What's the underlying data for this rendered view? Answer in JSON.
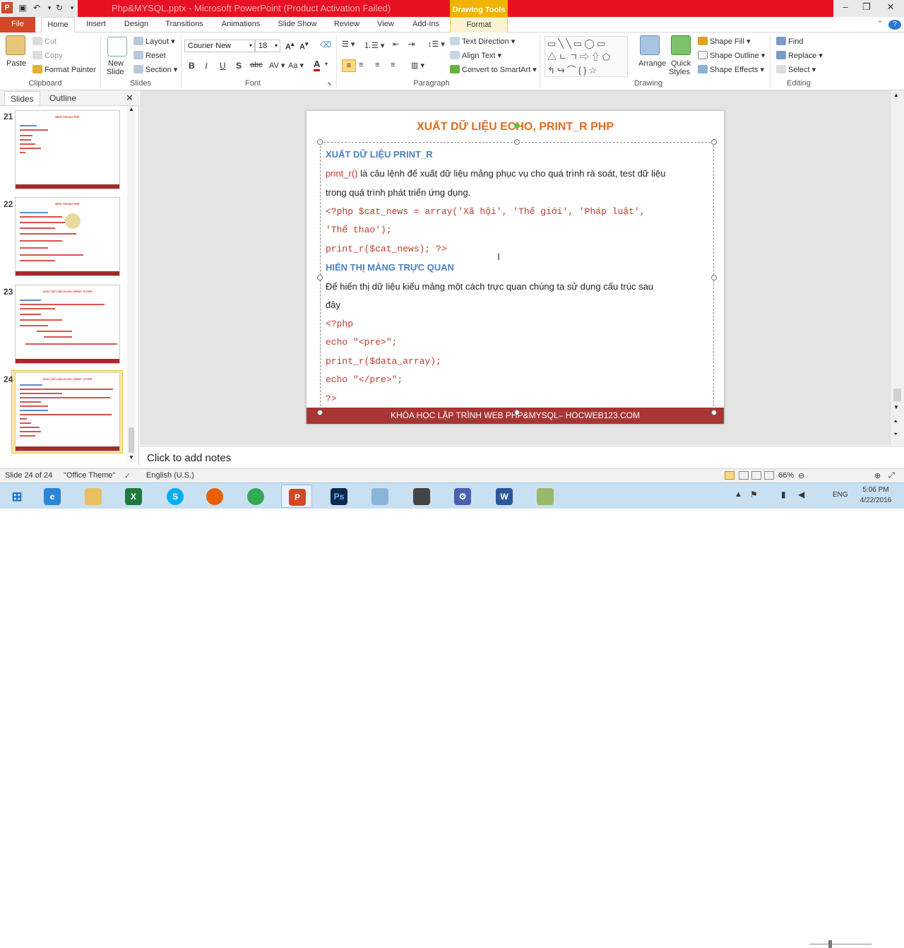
{
  "titlebar": {
    "title": "Php&MYSQL.pptx - Microsoft PowerPoint (Product Activation Failed)",
    "contextual_tab": "Drawing Tools"
  },
  "tabs": [
    "File",
    "Home",
    "Insert",
    "Design",
    "Transitions",
    "Animations",
    "Slide Show",
    "Review",
    "View",
    "Add-Ins",
    "Format"
  ],
  "ribbon": {
    "clipboard": {
      "paste": "Paste",
      "cut": "Cut",
      "copy": "Copy",
      "format_painter": "Format Painter",
      "label": "Clipboard"
    },
    "slides": {
      "new_slide_1": "New",
      "new_slide_2": "Slide",
      "layout": "Layout",
      "reset": "Reset",
      "section": "Section",
      "label": "Slides"
    },
    "font": {
      "name": "Courier New",
      "size": "18",
      "label": "Font"
    },
    "paragraph": {
      "text_direction": "Text Direction",
      "align_text": "Align Text",
      "smartart": "Convert to SmartArt",
      "label": "Paragraph"
    },
    "drawing": {
      "arrange": "Arrange",
      "quick_styles_1": "Quick",
      "quick_styles_2": "Styles",
      "shape_fill": "Shape Fill",
      "shape_outline": "Shape Outline",
      "shape_effects": "Shape Effects",
      "label": "Drawing"
    },
    "editing": {
      "find": "Find",
      "replace": "Replace",
      "select": "Select",
      "label": "Editing"
    }
  },
  "left_panel": {
    "tab_slides": "Slides",
    "tab_outline": "Outline",
    "thumbnails": [
      {
        "num": "21",
        "title": "BIẾN TRONG PHP"
      },
      {
        "num": "22",
        "title": "BIẾN TRONG PHP"
      },
      {
        "num": "23",
        "title": "XUẤT DỮ LIỆU ECHO, PRINT_R PHP"
      },
      {
        "num": "24",
        "title": "XUẤT DỮ LIỆU ECHO, PRINT_R PHP"
      }
    ]
  },
  "slide": {
    "title": "XUẤT DỮ LIỆU ECHO, PRINT_R PHP",
    "heading1": "XUẤT DỮ LIỆU PRINT_R",
    "p1_fn": "print_r()",
    "p1_rest": " là câu lệnh để xuất dữ liệu mảng phục vụ cho quá trình rà soát, test dữ liệu",
    "p1_line2": "trong quá trình phát triển ứng dụng.",
    "code1": "<?php $cat_news = array('Xã hội', 'Thế giới', 'Pháp luật',",
    "code2": "'Thể thao');",
    "code3": "print_r($cat_news); ?>",
    "heading2": "HIỂN THỊ MẢNG TRỰC QUAN",
    "p2_line1": "Để hiển thị dữ liệu kiểu mảng một cách trực quan chúng ta sử dụng cấu trúc sau",
    "p2_line2": "đây",
    "code4": "<?php",
    "code5": "echo \"<pre>\";",
    "code6": "print_r($data_array);",
    "code7": "echo \"</pre>\";",
    "code8": "?>",
    "footer": "KHÓA HỌC LẬP TRÌNH WEB PHP&MYSQL– HOCWEB123.COM"
  },
  "notes": {
    "placeholder": "Click to add notes"
  },
  "status": {
    "slide": "Slide 24 of 24",
    "theme": "\"Office Theme\"",
    "language": "English (U.S.)",
    "zoom": "66%"
  },
  "taskbar": {
    "lang": "ENG",
    "time": "5:06 PM",
    "date": "4/22/2016"
  }
}
